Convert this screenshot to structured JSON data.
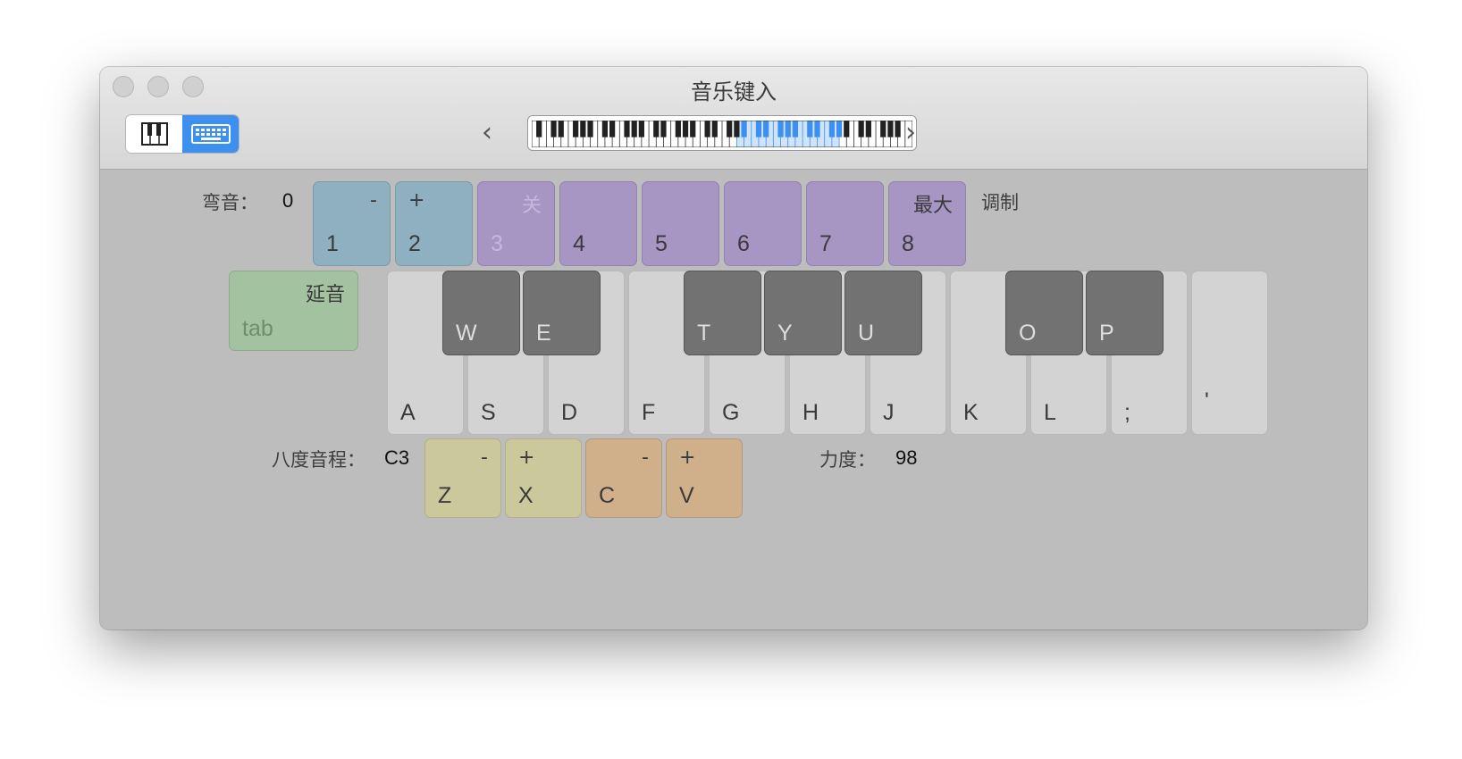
{
  "window": {
    "title": "音乐键入"
  },
  "toolbar": {
    "mode_buttons": [
      {
        "icon": "piano-keys-icon",
        "selected": false
      },
      {
        "icon": "computer-keyboard-icon",
        "selected": true
      }
    ],
    "prev_icon": "‹",
    "next_icon": "›",
    "range_icon": "mini-keyboard-range"
  },
  "colors": {
    "pitch_bend": "#8fb0c0",
    "modulation": "#a795c4",
    "sustain": "#a3c2a0",
    "octave": "#cbc89c",
    "velocity": "#cfb08a",
    "accent": "#3d8ff0"
  },
  "pitch_bend": {
    "label": "弯音：",
    "value": "0"
  },
  "modulation": {
    "label": "调制"
  },
  "octave": {
    "label": "八度音程：",
    "value": "C3"
  },
  "velocity": {
    "label": "力度：",
    "value": "98"
  },
  "top_row": [
    {
      "sym": "-",
      "key": "1"
    },
    {
      "sym": "+",
      "key": "2"
    },
    {
      "sym": "关",
      "key": "3"
    },
    {
      "sym": "",
      "key": "4"
    },
    {
      "sym": "",
      "key": "5"
    },
    {
      "sym": "",
      "key": "6"
    },
    {
      "sym": "",
      "key": "7"
    },
    {
      "sym": "最大",
      "key": "8"
    }
  ],
  "sustain": {
    "label": "延音",
    "key": "tab"
  },
  "white_keys": [
    "A",
    "S",
    "D",
    "F",
    "G",
    "H",
    "J",
    "K",
    "L",
    ";",
    "'"
  ],
  "black_keys": [
    "W",
    "E",
    "T",
    "Y",
    "U",
    "O",
    "P"
  ],
  "bottom_row": [
    {
      "sym": "-",
      "key": "Z"
    },
    {
      "sym": "+",
      "key": "X"
    },
    {
      "sym": "-",
      "key": "C"
    },
    {
      "sym": "+",
      "key": "V"
    }
  ]
}
